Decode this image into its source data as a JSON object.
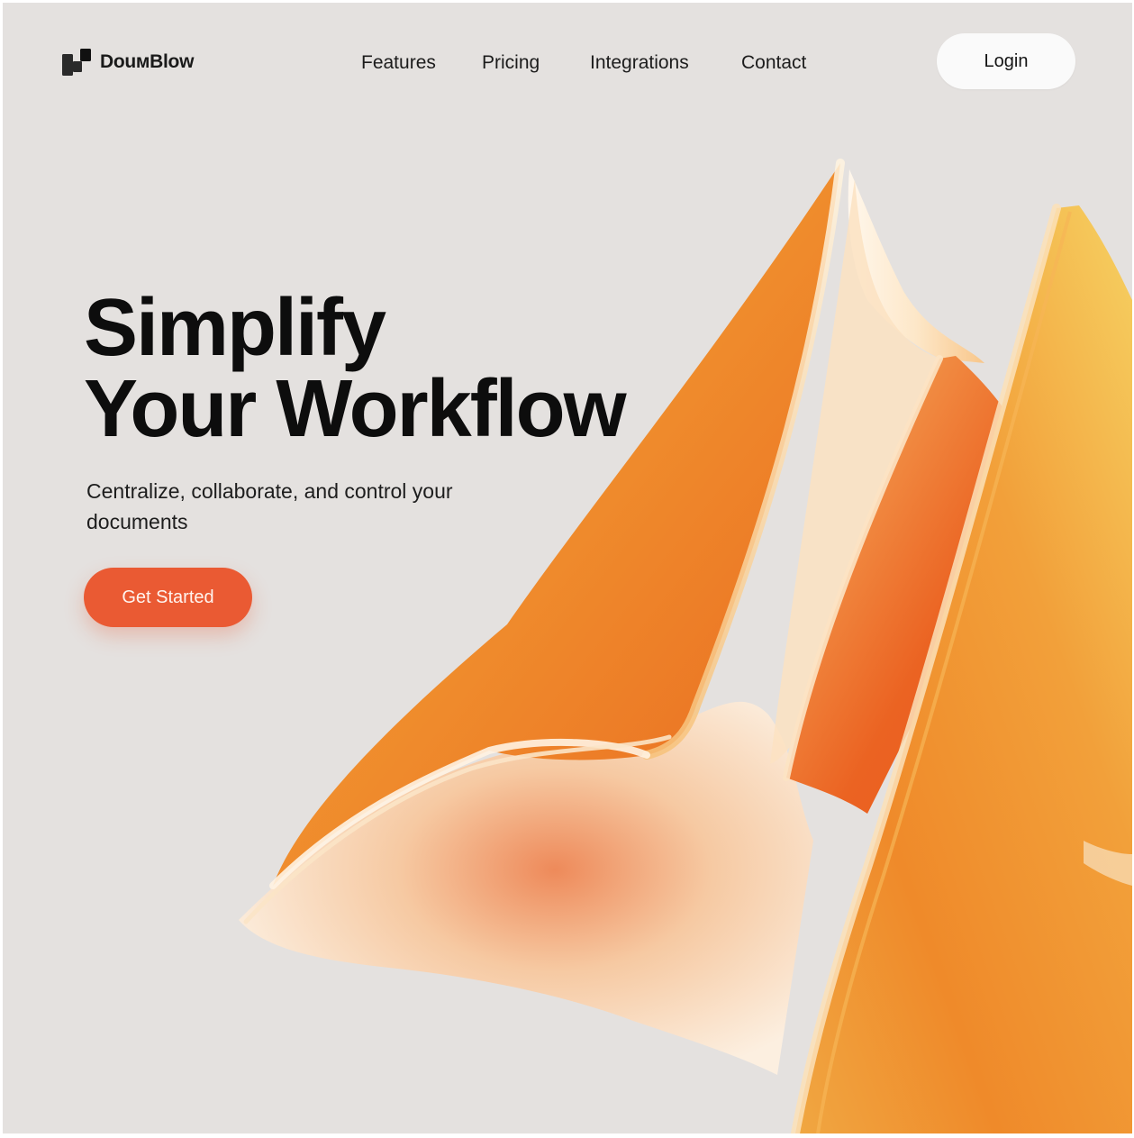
{
  "brand": {
    "name": "DouмBlow",
    "logo_icon": "stacked-squares-logo-icon",
    "color": "#1a1a1a"
  },
  "nav": {
    "links": [
      "Features",
      "Pricing",
      "Integrations",
      "Contact"
    ],
    "login_label": "Login"
  },
  "hero": {
    "title_line1": "Simplify",
    "title_line2": "Your Workflow",
    "subtitle": "Centralize, collaborate, and control your documents",
    "cta_label": "Get Started",
    "cta_color": "#ea5a33"
  },
  "theme": {
    "background": "#e4e1df",
    "accent_orange": "#f08a2c",
    "accent_yellow": "#f5c84c"
  }
}
